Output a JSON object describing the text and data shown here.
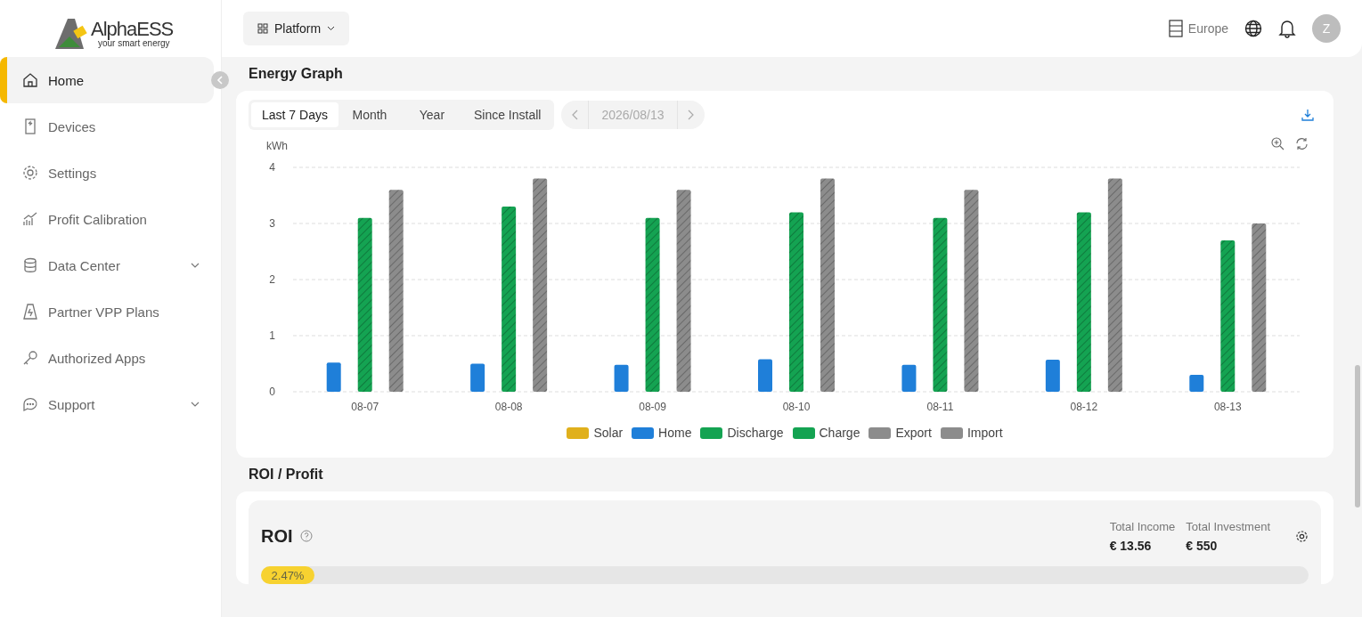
{
  "logo": {
    "name": "AlphaESS",
    "tagline": "your smart energy"
  },
  "sidebar": {
    "items": [
      {
        "label": "Home",
        "selected": true,
        "expandable": false
      },
      {
        "label": "Devices",
        "selected": false,
        "expandable": false
      },
      {
        "label": "Settings",
        "selected": false,
        "expandable": false
      },
      {
        "label": "Profit Calibration",
        "selected": false,
        "expandable": false
      },
      {
        "label": "Data Center",
        "selected": false,
        "expandable": true
      },
      {
        "label": "Partner VPP Plans",
        "selected": false,
        "expandable": false
      },
      {
        "label": "Authorized Apps",
        "selected": false,
        "expandable": false
      },
      {
        "label": "Support",
        "selected": false,
        "expandable": true
      }
    ]
  },
  "topbar": {
    "platform": "Platform",
    "region": "Europe",
    "avatar": "Z"
  },
  "energy_graph": {
    "title": "Energy Graph",
    "tabs": [
      {
        "label": "Last 7 Days",
        "selected": true
      },
      {
        "label": "Month",
        "selected": false
      },
      {
        "label": "Year",
        "selected": false
      },
      {
        "label": "Since Install",
        "selected": false
      }
    ],
    "date": "2026/08/13",
    "chart_data": {
      "type": "bar",
      "ylabel": "kWh",
      "grid": true,
      "categories": [
        "08-07",
        "08-08",
        "08-09",
        "08-10",
        "08-11",
        "08-12",
        "08-13"
      ],
      "ylim": [
        0,
        4
      ],
      "yticks": [
        0,
        1,
        2,
        3,
        4
      ],
      "series": [
        {
          "name": "Solar",
          "color": "#e0b01c",
          "values": [
            0,
            0,
            0,
            0,
            0,
            0,
            0
          ]
        },
        {
          "name": "Home",
          "color": "#1f7fd9",
          "values": [
            0.52,
            0.5,
            0.48,
            0.58,
            0.48,
            0.57,
            0.3
          ]
        },
        {
          "name": "Discharge",
          "color": "#14a352",
          "values": [
            0,
            0,
            0,
            0,
            0,
            0,
            0
          ]
        },
        {
          "name": "Charge",
          "color": "#14a352",
          "values": [
            3.1,
            3.3,
            3.1,
            3.2,
            3.1,
            3.2,
            2.7
          ]
        },
        {
          "name": "Export",
          "color": "#8c8c8c",
          "values": [
            0,
            0,
            0,
            0,
            0,
            0,
            0
          ]
        },
        {
          "name": "Import",
          "color": "#8c8c8c",
          "values": [
            3.6,
            3.8,
            3.6,
            3.8,
            3.6,
            3.8,
            3.0
          ]
        }
      ]
    }
  },
  "roi_section": {
    "title": "ROI / Profit",
    "roi_title": "ROI",
    "total_income_label": "Total Income",
    "total_income": "€ 13.56",
    "total_investment_label": "Total Investment",
    "total_investment": "€ 550",
    "progress": {
      "label": "2.47%",
      "level": 0.0247
    }
  }
}
